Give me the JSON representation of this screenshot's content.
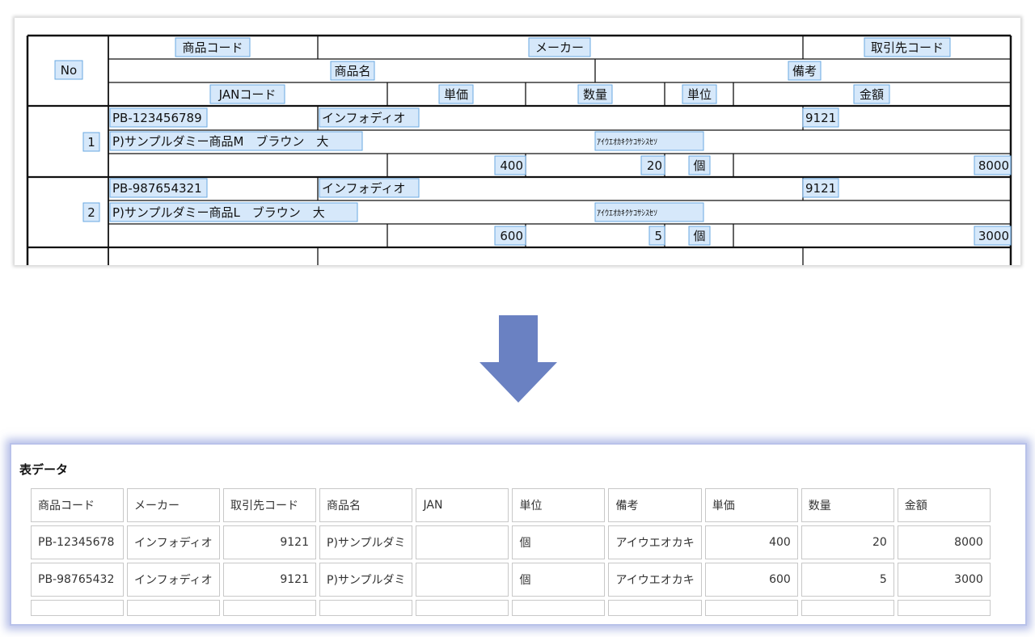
{
  "form": {
    "headers": {
      "no": "No",
      "product_code": "商品コード",
      "maker": "メーカー",
      "supplier_code": "取引先コード",
      "product_name": "商品名",
      "remarks": "備考",
      "jan_code": "JANコード",
      "unit_price": "単価",
      "quantity": "数量",
      "unit": "単位",
      "amount": "金額"
    },
    "rows": [
      {
        "no": "1",
        "product_code": "PB-123456789",
        "maker": "インフォディオ",
        "supplier_code": "9121",
        "product_name": "P)サンプルダミー商品M　ブラウン　大",
        "remarks": "ｱｲｳｴｵｶｷｸｹｺｻｼｽｾｿ",
        "unit_price": "400",
        "quantity": "20",
        "unit": "個",
        "amount": "8000"
      },
      {
        "no": "2",
        "product_code": "PB-987654321",
        "maker": "インフォディオ",
        "supplier_code": "9121",
        "product_name": "P)サンプルダミー商品L　ブラウン　大",
        "remarks": "ｱｲｳｴｵｶｷｸｹｺｻｼｽｾｿ",
        "unit_price": "600",
        "quantity": "5",
        "unit": "個",
        "amount": "3000"
      }
    ]
  },
  "arrow": {
    "icon": "down-arrow-icon",
    "color": "#6a81c2"
  },
  "table": {
    "title": "表データ",
    "columns": [
      "商品コード",
      "メーカー",
      "取引先コード",
      "商品名",
      "JAN",
      "単位",
      "備考",
      "単価",
      "数量",
      "金額"
    ],
    "rows": [
      [
        "PB-12345678",
        "インフォディオ",
        "9121",
        "P)サンプルダミ",
        "",
        "個",
        "アイウエオカキ",
        "400",
        "20",
        "8000"
      ],
      [
        "PB-98765432",
        "インフォディオ",
        "9121",
        "P)サンプルダミ",
        "",
        "個",
        "アイウエオカキ",
        "600",
        "5",
        "3000"
      ]
    ]
  },
  "colors": {
    "highlight_fill": "#d6e8fa",
    "highlight_border": "#6aa9e2",
    "panel_glow": "#7e8ed6"
  }
}
